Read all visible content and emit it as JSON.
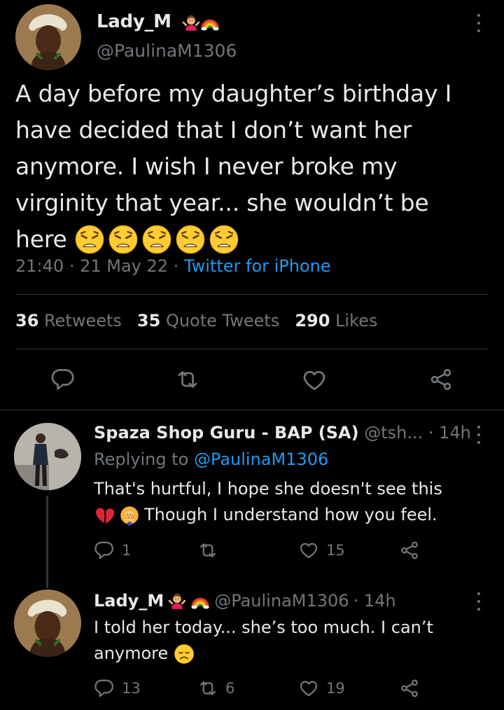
{
  "main_tweet": {
    "display_name": "Lady_M",
    "handle": "@PaulinaM1306",
    "text_lines": [
      "A day before my daughter’s birthday I",
      "have decided that I don’t want her",
      "anymore. I wish I never broke my",
      "virginity that year... she wouldn’t be",
      "here"
    ],
    "time": "21:40",
    "date": "21 May 22",
    "source": "Twitter for iPhone",
    "retweets_count": "36",
    "retweets_label": "Retweets",
    "quotes_count": "35",
    "quotes_label": "Quote Tweets",
    "likes_count": "290",
    "likes_label": "Likes"
  },
  "replies": [
    {
      "display_name": "Spaza Shop Guru - BAP (SA)",
      "handle": "@tsh...",
      "time": "· 14h",
      "replying_to_label": "Replying to",
      "replying_to_handle": "@PaulinaM1306",
      "text_line1": "That's hurtful, I hope she doesn't see this",
      "text_line2": "Though I understand how you feel.",
      "reply_count": "1",
      "retweet_count": "",
      "like_count": "15"
    },
    {
      "display_name": "Lady_M",
      "handle": "@PaulinaM1306",
      "time": "· 14h",
      "text_line1": "I told her today... she’s too much. I can’t",
      "text_line2": "anymore",
      "reply_count": "13",
      "retweet_count": "6",
      "like_count": "19"
    }
  ],
  "colors": {
    "background": "#000000",
    "text": "#e7e9ea",
    "muted": "#71767b",
    "link": "#1d9bf0",
    "divider": "#2f3336"
  },
  "icons": [
    "more-icon",
    "reply-icon",
    "retweet-icon",
    "like-icon",
    "share-icon",
    "weary-emoji",
    "rainbow-emoji",
    "woman-shrugging-emoji",
    "broken-heart-emoji",
    "disappointed-emoji"
  ]
}
